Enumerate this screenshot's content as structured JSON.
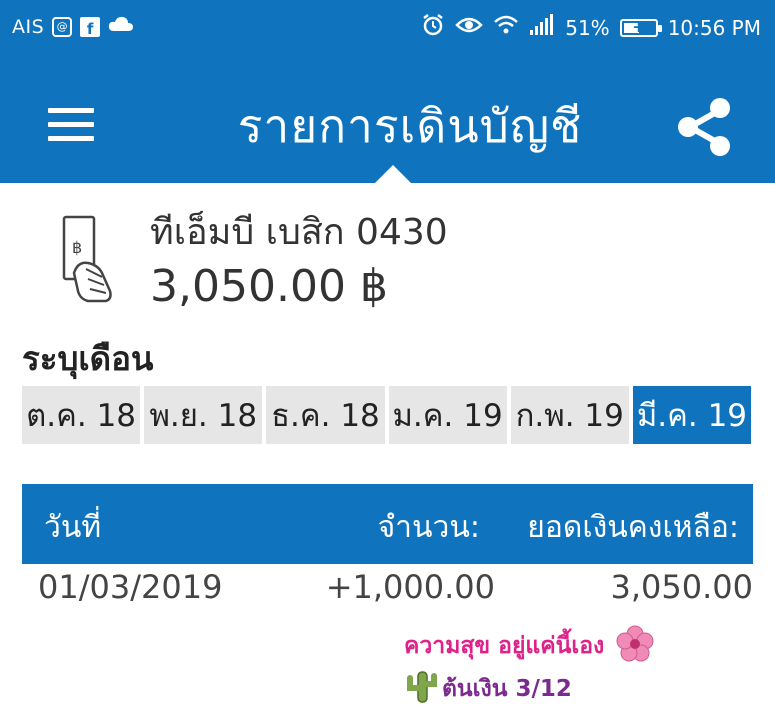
{
  "status_bar": {
    "carrier": "AIS",
    "battery": "51%",
    "time": "10:56 PM",
    "battery_level": 0.51
  },
  "app_bar": {
    "title": "รายการเดินบัญชี"
  },
  "account": {
    "name": "ทีเอ็มบี เบสิก 0430",
    "balance": "3,050.00 ฿"
  },
  "month_selector": {
    "label": "ระบุเดือน",
    "months": [
      "ต.ค. 18",
      "พ.ย. 18",
      "ธ.ค. 18",
      "ม.ค. 19",
      "ก.พ. 19",
      "มี.ค. 19"
    ],
    "selected_index": 5
  },
  "table": {
    "headers": {
      "date": "วันที่",
      "amount": "จำนวน:",
      "balance": "ยอดเงินคงเหลือ:"
    },
    "rows": [
      {
        "date": "01/03/2019",
        "amount": "+1,000.00",
        "balance": "3,050.00"
      }
    ]
  },
  "stickers": {
    "line1": "ความสุข อยู่แค่นี้เอง",
    "line2": "ต้นเงิน 3/12"
  },
  "colors": {
    "primary": "#0f74bd",
    "tab_inactive": "#e6e6e6",
    "sticker_pink": "#e0218a",
    "sticker_purple": "#7b2a8e"
  }
}
